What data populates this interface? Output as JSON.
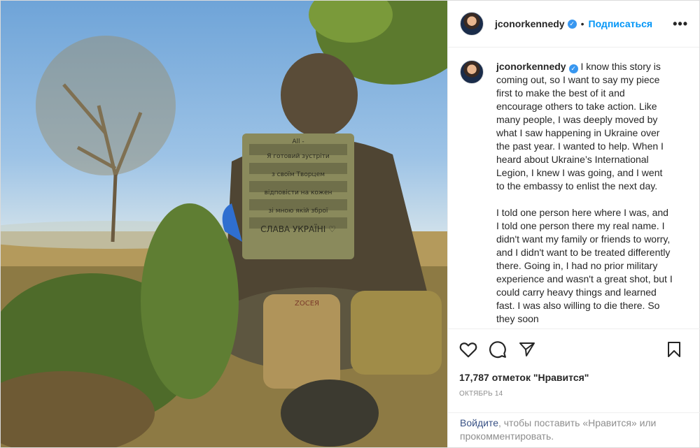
{
  "post": {
    "username": "jconorkennedy",
    "verified_icon": "verified-badge-icon",
    "separator": "•",
    "follow_label": "Подписаться",
    "more_label": "•••",
    "caption_paragraphs": [
      "I know this story is coming out, so I want to say my piece first to make the best of it and encourage others to take action. Like many people, I was deeply moved by what I saw happening in Ukraine over the past year. I wanted to help. When I heard about Ukraine’s International Legion, I knew I was going, and I went to the embassy to enlist the next day.",
      "I told one person here where I was, and I told one person there my real name. I didn't want my family or friends to worry, and I didn't want to be treated differently there. Going in, I had no prior military experience and wasn't a great shot, but I could carry heavy things and learned fast. I was also willing to die there. So they soon"
    ],
    "likes": "17,787 отметок \"Нравится\"",
    "date": "ОКТЯБРЬ 14",
    "login_link": "Войдите",
    "login_text": ", чтобы поставить «Нравится» или прокомментировать.",
    "photo": {
      "vest_lines": [
        "All -",
        "Я готовий зустріти",
        "з своїм Творцем",
        "відповісти на кожен",
        "зі мною якій зброї",
        "СЛАВА УКРАЇНІ ♡"
      ],
      "pouch_text": "ZOCEЯ"
    }
  },
  "icons": {
    "like": "heart-icon",
    "comment": "comment-icon",
    "share": "share-icon",
    "save": "bookmark-icon"
  }
}
